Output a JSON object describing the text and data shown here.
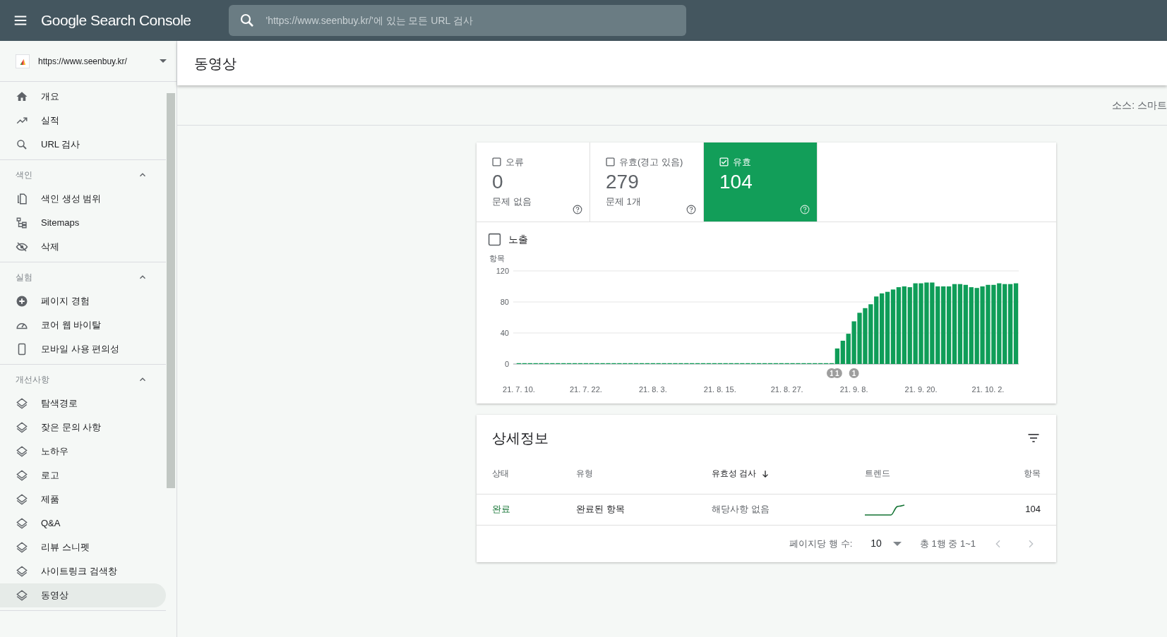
{
  "app": {
    "title": "Google Search Console",
    "search": {
      "placeholder": "'https://www.seenbuy.kr/'에 있는 모든 URL 검사"
    }
  },
  "property": {
    "url": "https://www.seenbuy.kr/"
  },
  "sidebar": {
    "items": [
      {
        "label": "개요",
        "selected": false
      },
      {
        "label": "실적",
        "selected": false
      },
      {
        "label": "URL 검사",
        "selected": false
      }
    ],
    "sections": [
      {
        "title": "색인",
        "expanded": true,
        "items": [
          {
            "label": "색인 생성 범위",
            "selected": false
          },
          {
            "label": "Sitemaps",
            "selected": false
          },
          {
            "label": "삭제",
            "selected": false
          }
        ]
      },
      {
        "title": "실험",
        "expanded": true,
        "items": [
          {
            "label": "페이지 경험",
            "selected": false
          },
          {
            "label": "코어 웹 바이탈",
            "selected": false
          },
          {
            "label": "모바일 사용 편의성",
            "selected": false
          }
        ]
      },
      {
        "title": "개선사항",
        "expanded": true,
        "items": [
          {
            "label": "탐색경로",
            "selected": false
          },
          {
            "label": "잦은 문의 사항",
            "selected": false
          },
          {
            "label": "노하우",
            "selected": false
          },
          {
            "label": "로고",
            "selected": false
          },
          {
            "label": "제품",
            "selected": false
          },
          {
            "label": "Q&A",
            "selected": false
          },
          {
            "label": "리뷰 스니펫",
            "selected": false
          },
          {
            "label": "사이트링크 검색창",
            "selected": false
          },
          {
            "label": "동영상",
            "selected": true
          }
        ]
      }
    ]
  },
  "page": {
    "title": "동영상",
    "source": "소스: 스마트"
  },
  "status_tiles": [
    {
      "label": "오류",
      "count": "0",
      "caption": "문제 없음",
      "checked": false
    },
    {
      "label": "유효(경고 있음)",
      "count": "279",
      "caption": "문제 1개",
      "checked": false
    },
    {
      "label": "유효",
      "count": "104",
      "checked": true
    }
  ],
  "impressions": {
    "label": "노출",
    "checked": false
  },
  "chart": {
    "chart_data": {
      "type": "bar",
      "ylabel": "항목",
      "categories": [
        "21. 7. 10.",
        null,
        null,
        null,
        null,
        null,
        null,
        null,
        null,
        null,
        null,
        null,
        "21. 7. 22.",
        null,
        null,
        null,
        null,
        null,
        null,
        null,
        null,
        null,
        null,
        null,
        "21. 8. 3.",
        null,
        null,
        null,
        null,
        null,
        null,
        null,
        null,
        null,
        null,
        null,
        "21. 8. 15.",
        null,
        null,
        null,
        null,
        null,
        null,
        null,
        null,
        null,
        null,
        null,
        "21. 8. 27.",
        null,
        null,
        null,
        null,
        null,
        null,
        null,
        null,
        null,
        null,
        null,
        "21. 9. 8.",
        null,
        null,
        null,
        null,
        null,
        null,
        null,
        null,
        null,
        null,
        null,
        "21. 9. 20.",
        null,
        null,
        null,
        null,
        null,
        null,
        null,
        null,
        null,
        null,
        null,
        "21. 10. 2.",
        null,
        null,
        null,
        null,
        null
      ],
      "series": [
        {
          "color": "#0f9d58",
          "values": [
            0,
            0,
            0,
            0,
            0,
            0,
            0,
            0,
            0,
            0,
            0,
            0,
            0,
            0,
            0,
            0,
            0,
            0,
            0,
            0,
            0,
            0,
            0,
            0,
            0,
            0,
            0,
            0,
            0,
            0,
            0,
            0,
            0,
            0,
            0,
            0,
            0,
            0,
            0,
            0,
            0,
            0,
            0,
            0,
            0,
            0,
            0,
            0,
            0,
            0,
            0,
            0,
            0,
            0,
            0,
            0,
            1,
            20,
            30,
            39,
            55,
            66,
            72,
            77,
            87,
            91,
            93,
            96,
            99,
            100,
            99,
            104,
            104,
            105,
            105,
            100,
            100,
            100,
            103,
            103,
            102,
            99,
            98,
            100,
            102,
            102,
            104,
            103,
            103,
            104
          ]
        }
      ],
      "ylim": [
        0,
        120
      ],
      "yticks": [
        {
          "value": 0,
          "label": "0"
        },
        {
          "value": 40,
          "label": "40"
        },
        {
          "value": 80,
          "label": "80"
        },
        {
          "value": 120,
          "label": "120"
        }
      ],
      "annotations": [
        "1",
        "1",
        "1"
      ]
    }
  },
  "details": {
    "title": "상세정보",
    "columns": [
      {
        "label": "상태",
        "sorted": false
      },
      {
        "label": "유형",
        "sorted": false
      },
      {
        "label": "유효성 검사",
        "sorted": true
      },
      {
        "label": "트렌드",
        "sorted": false
      },
      {
        "label": "항목",
        "sorted": false
      }
    ],
    "rows": [
      {
        "status": "완료",
        "type": "완료된 항목",
        "validation": "해당사항 없음",
        "count": "104"
      }
    ],
    "pagination": {
      "rows_label": "페이지당 행 수:",
      "rows_per_page": "10",
      "range": "총 1행 중 1~1"
    }
  }
}
